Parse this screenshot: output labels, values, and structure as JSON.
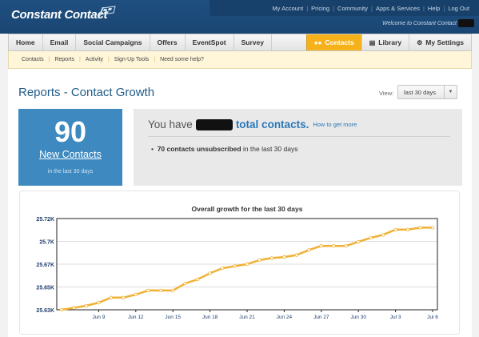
{
  "header": {
    "logo_text": "Constant Contact",
    "links": [
      "My Account",
      "Pricing",
      "Community",
      "Apps & Services",
      "Help",
      "Log Out"
    ],
    "welcome": "Welcome to Constant Contact"
  },
  "nav": {
    "left": [
      "Home",
      "Email",
      "Social Campaigns",
      "Offers",
      "EventSpot",
      "Survey"
    ],
    "contacts": "Contacts",
    "library": "Library",
    "settings": "My Settings"
  },
  "subnav": [
    "Contacts",
    "Reports",
    "Activity",
    "Sign-Up Tools",
    "Need some help?"
  ],
  "page": {
    "title": "Reports - Contact Growth",
    "view_label": "View:",
    "view_value": "last 30 days"
  },
  "stat": {
    "number": "90",
    "label": "New Contacts",
    "sub": "in the last 30 days"
  },
  "summary": {
    "prefix": "You have",
    "total": "total contacts.",
    "how_link": "How to get more",
    "unsub_bold": "70 contacts unsubscribed",
    "unsub_rest": " in the last 30 days"
  },
  "colors": {
    "brand_blue": "#1f4f80",
    "accent_orange": "#f5b21a",
    "stat_blue": "#3e8ac0",
    "line": "#f0b133"
  },
  "chart_data": {
    "type": "line",
    "title": "Overall growth for the last 30 days",
    "xlabel": "",
    "ylabel": "",
    "x_ticks": [
      "Jun 9",
      "Jun 12",
      "Jun 15",
      "Jun 18",
      "Jun 21",
      "Jun 24",
      "Jun 27",
      "Jun 30",
      "Jul 3",
      "Jul 6"
    ],
    "y_tick_labels": [
      "25.72K",
      "25.7K",
      "25.67K",
      "25.65K",
      "25.63K"
    ],
    "y_ticks": [
      25720,
      25697.5,
      25675,
      25652.5,
      25630
    ],
    "ylim": [
      25630,
      25720
    ],
    "grid": true,
    "x": [
      "Jun 6",
      "Jun 7",
      "Jun 8",
      "Jun 9",
      "Jun 10",
      "Jun 11",
      "Jun 12",
      "Jun 13",
      "Jun 14",
      "Jun 15",
      "Jun 16",
      "Jun 17",
      "Jun 18",
      "Jun 19",
      "Jun 20",
      "Jun 21",
      "Jun 22",
      "Jun 23",
      "Jun 24",
      "Jun 25",
      "Jun 26",
      "Jun 27",
      "Jun 28",
      "Jun 29",
      "Jun 30",
      "Jul 1",
      "Jul 2",
      "Jul 3",
      "Jul 4",
      "Jul 5",
      "Jul 6"
    ],
    "values": [
      25630,
      25632,
      25634,
      25637,
      25642,
      25642,
      25645,
      25649,
      25649,
      25649,
      25656,
      25660,
      25666,
      25671,
      25673,
      25675,
      25679,
      25681,
      25682,
      25684,
      25689,
      25693,
      25693,
      25693,
      25697,
      25701,
      25704,
      25709,
      25709,
      25711,
      25711
    ]
  }
}
